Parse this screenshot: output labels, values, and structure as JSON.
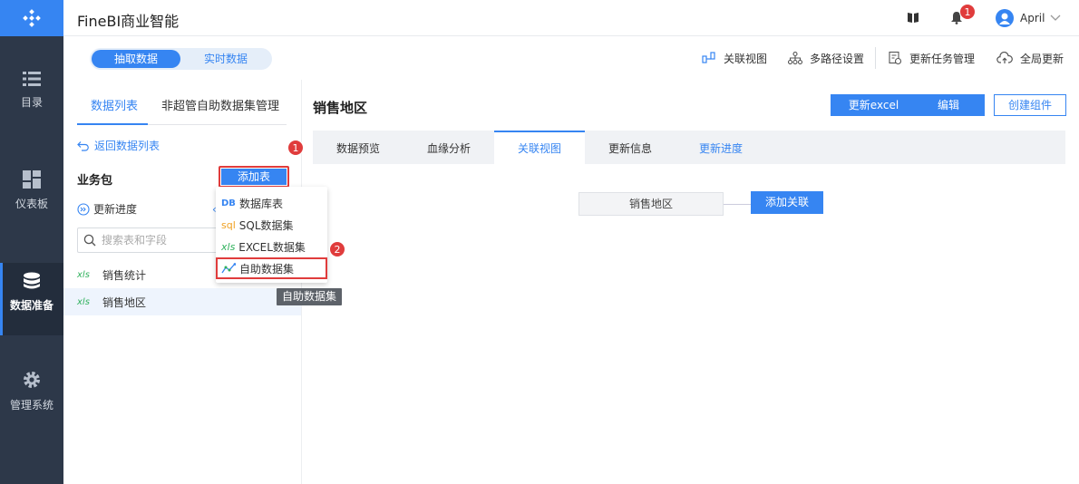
{
  "app": {
    "title": "FineBI商业智能"
  },
  "nav": {
    "items": [
      {
        "label": "目录",
        "icon": "list-icon"
      },
      {
        "label": "仪表板",
        "icon": "dashboard-icon"
      },
      {
        "label": "数据准备",
        "icon": "database-icon",
        "active": true
      },
      {
        "label": "管理系统",
        "icon": "gear-icon"
      }
    ]
  },
  "header": {
    "notification_count": "1",
    "user": "April"
  },
  "toolbar": {
    "seg_extract": "抽取数据",
    "seg_realtime": "实时数据",
    "relation_view": "关联视图",
    "multipath": "多路径设置",
    "update_task": "更新任务管理",
    "global_update": "全局更新"
  },
  "left": {
    "tabs": [
      "数据列表",
      "非超管自助数据集管理"
    ],
    "back": "返回数据列表",
    "package": "业务包",
    "add_table": "添加表",
    "update_progress": "更新进度",
    "search_placeholder": "搜索表和字段",
    "tables": [
      {
        "label": "销售统计",
        "icon": "xls"
      },
      {
        "label": "销售地区",
        "icon": "xls",
        "selected": true
      }
    ]
  },
  "dropdown": {
    "items": [
      {
        "icon": "DB",
        "label": "数据库表"
      },
      {
        "icon": "sql",
        "label": "SQL数据集"
      },
      {
        "icon": "xls",
        "label": "EXCEL数据集"
      },
      {
        "icon": "self-service",
        "label": "自助数据集"
      }
    ],
    "tooltip": "自助数据集"
  },
  "annotations": {
    "step1": "1",
    "step2": "2"
  },
  "main": {
    "title": "销售地区",
    "buttons": {
      "update_excel": "更新excel",
      "edit": "编辑",
      "create_component": "创建组件"
    },
    "tabs": [
      "数据预览",
      "血缘分析",
      "关联视图",
      "更新信息",
      "更新进度"
    ],
    "node": "销售地区",
    "add_relation": "添加关联"
  },
  "colors": {
    "accent": "#3685f2",
    "nav_bg": "#2d3849",
    "highlight": "#e03c3c"
  }
}
